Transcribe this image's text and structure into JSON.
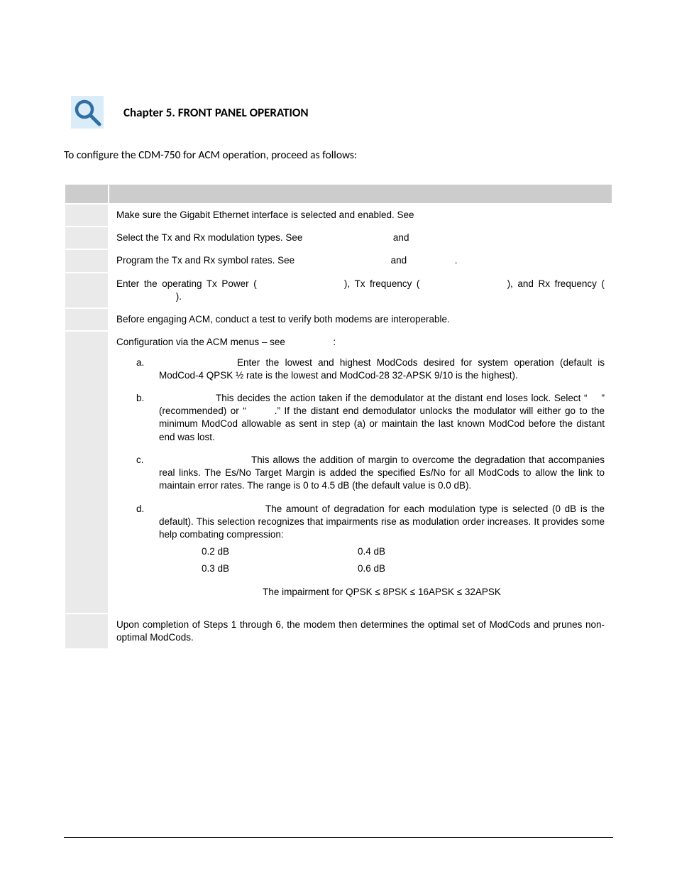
{
  "chapter_title": "Chapter 5. FRONT PANEL OPERATION",
  "intro": "To configure the CDM-750 for ACM operation, proceed as follows:",
  "table": {
    "head": {
      "col1": "",
      "col2": ""
    },
    "rows": {
      "r1": {
        "num": "",
        "desc": "Make sure the Gigabit Ethernet interface is selected and enabled. See"
      },
      "r2": {
        "num": "",
        "p1a": "Select the Tx and Rx modulation types. See ",
        "p1b": "and"
      },
      "r3": {
        "num": "",
        "p1a": "Program the Tx and Rx symbol rates. See ",
        "p1b": "and",
        "p1c": "."
      },
      "r4": {
        "num": "",
        "p1a": "Enter the operating Tx Power (",
        "p1b": "), Tx frequency (",
        "p1c": "), and Rx frequency (",
        "p1d": ")."
      },
      "r5": {
        "num": "",
        "desc": "Before engaging ACM, conduct a test to verify both modems are interoperable."
      },
      "r6": {
        "num": "",
        "intro_a": "Configuration via the ACM menus – see ",
        "intro_b": ":",
        "a": {
          "letter": "a.",
          "body": "Enter the lowest and highest ModCods desired for system operation (default is ModCod-4 QPSK ½ rate is the lowest and ModCod-28 32-APSK 9/10 is the highest)."
        },
        "b": {
          "letter": "b.",
          "b1": "This decides the action taken if the demodulator at the distant end loses lock. Select “",
          "b2": "” (recommended) or “",
          "b3": ".” If the distant end demodulator unlocks the modulator will either go to the minimum ModCod allowable as sent in step (a) or maintain the last known ModCod before the distant end was lost."
        },
        "c": {
          "letter": "c.",
          "body": "This allows the addition of margin to overcome the degradation that accompanies real links. The Es/No Target Margin is added the specified Es/No for all ModCods to allow the link to maintain error rates. The range is 0 to 4.5 dB (the default value is 0.0 dB)."
        },
        "d": {
          "letter": "d.",
          "body1": "The amount of degradation for each modulation type is selected (0 dB is the default). This selection recognizes that impairments rise as modulation order increases. It provides some help combating compression:",
          "db": {
            "l1": "0.2 dB",
            "r1": "0.4 dB",
            "l2": "0.3 dB",
            "r2": "0.6 dB"
          },
          "impairment": "The impairment for QPSK ≤ 8PSK ≤ 16APSK ≤ 32APSK"
        }
      },
      "r7": {
        "num": "",
        "desc": "Upon completion of Steps 1 through 6, the modem then determines the optimal set of ModCods and prunes non-optimal ModCods."
      }
    }
  },
  "icon_name": "magnifier-icon"
}
